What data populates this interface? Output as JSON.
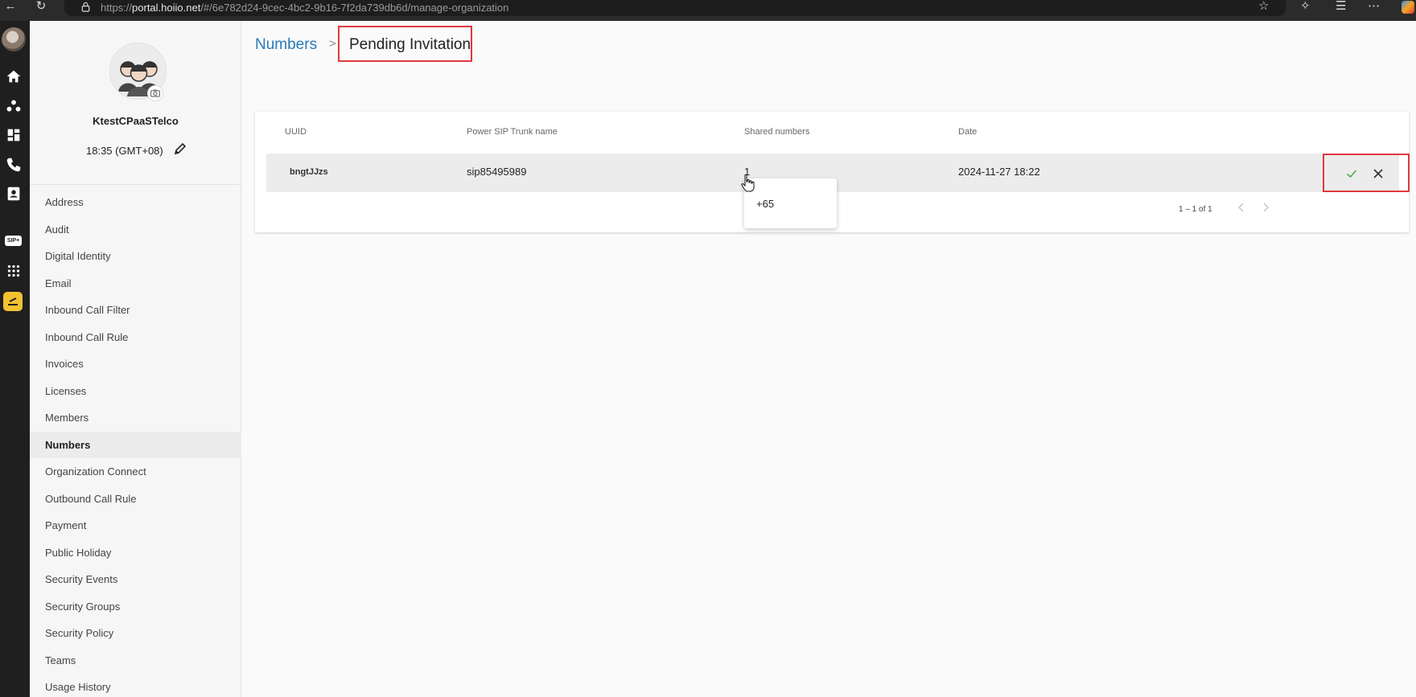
{
  "browser": {
    "url_prefix": "https://",
    "url_host": "portal.hoiio.net",
    "url_path": "/#/6e782d24-9cec-4bc2-9b16-7f2da739db6d/manage-organization"
  },
  "sidebar": {
    "org_name": "KtestCPaaSTelco",
    "org_time": "18:35 (GMT+08)",
    "items": [
      {
        "label": "Address"
      },
      {
        "label": "Audit"
      },
      {
        "label": "Digital Identity"
      },
      {
        "label": "Email"
      },
      {
        "label": "Inbound Call Filter"
      },
      {
        "label": "Inbound Call Rule"
      },
      {
        "label": "Invoices"
      },
      {
        "label": "Licenses"
      },
      {
        "label": "Members"
      },
      {
        "label": "Numbers"
      },
      {
        "label": "Organization Connect"
      },
      {
        "label": "Outbound Call Rule"
      },
      {
        "label": "Payment"
      },
      {
        "label": "Public Holiday"
      },
      {
        "label": "Security Events"
      },
      {
        "label": "Security Groups"
      },
      {
        "label": "Security Policy"
      },
      {
        "label": "Teams"
      },
      {
        "label": "Usage History"
      }
    ],
    "active_item": "Numbers"
  },
  "rail": {
    "sip_label": "SIP+"
  },
  "breadcrumb": {
    "parent": "Numbers",
    "current": "Pending Invitation"
  },
  "table": {
    "columns": [
      "UUID",
      "Power SIP Trunk name",
      "Shared numbers",
      "Date"
    ],
    "rows": [
      {
        "uuid": "bngtJJzs",
        "trunk": "sip85495989",
        "shared": "1",
        "date": "2024-11-27 18:22"
      }
    ],
    "pagination": "1 – 1 of 1"
  },
  "popup": {
    "items": [
      "+65"
    ]
  },
  "colors": {
    "accent": "#2a79b8",
    "highlight": "#e0393e",
    "accept": "#4caf50"
  }
}
